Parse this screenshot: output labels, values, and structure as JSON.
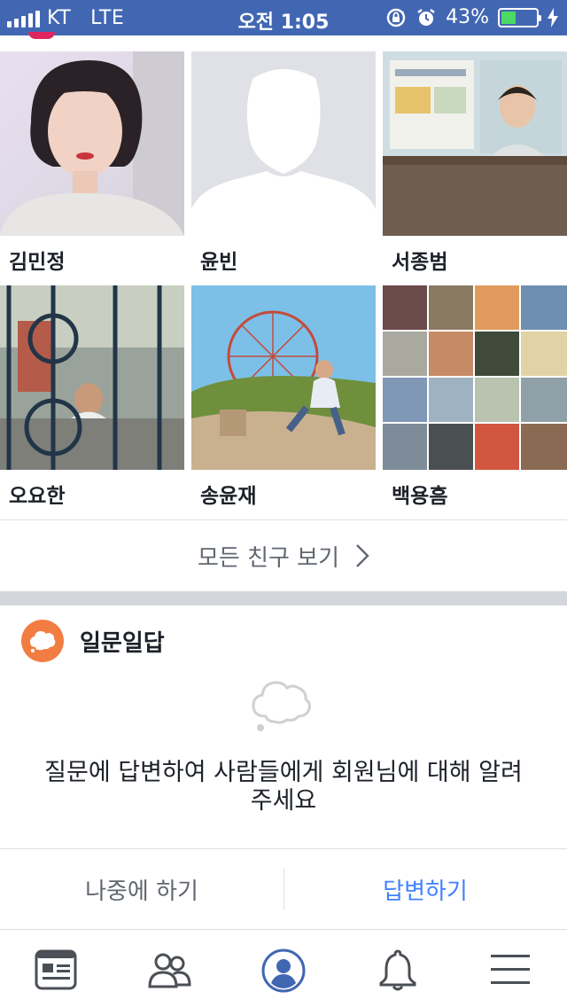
{
  "status_bar": {
    "carrier": "KT",
    "network": "LTE",
    "time": "오전 1:05",
    "battery_percent": "43%",
    "battery_level": 0.43,
    "battery_color": "#4cd964",
    "bar_color": "#4267b2",
    "icons": [
      "signal-icon",
      "rotation-lock-icon",
      "alarm-icon",
      "battery-icon",
      "charging-bolt-icon"
    ]
  },
  "friends": [
    {
      "name": "김민정"
    },
    {
      "name": "윤빈"
    },
    {
      "name": "서종범"
    },
    {
      "name": "오요한"
    },
    {
      "name": "송윤재"
    },
    {
      "name": "백용흠"
    }
  ],
  "see_all_label": "모든 친구 보기",
  "qa_card": {
    "title": "일문일답",
    "description": "질문에 답변하여 사람들에게 회원님에 대해 알려주세요",
    "later_label": "나중에 하기",
    "answer_label": "답변하기",
    "accent_color": "#f27d42",
    "link_color": "#4080ff"
  },
  "tab_bar": {
    "tabs": [
      "news-feed-icon",
      "friends-icon",
      "profile-icon",
      "notifications-icon",
      "menu-icon"
    ],
    "active_tab": "profile-icon",
    "active_color": "#4267b2"
  }
}
